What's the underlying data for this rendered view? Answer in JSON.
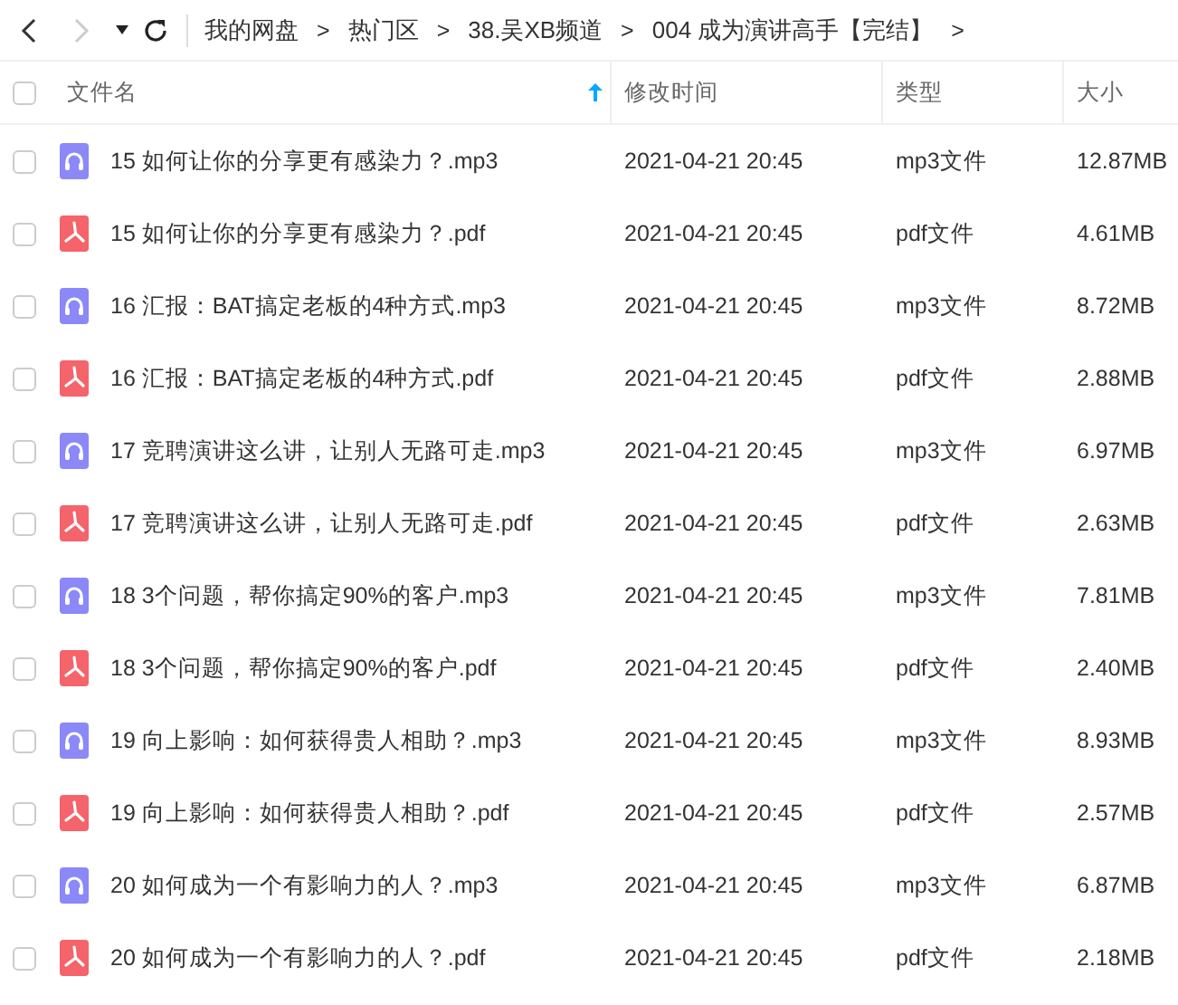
{
  "toolbar": {
    "back_disabled": false,
    "forward_disabled": true
  },
  "breadcrumbs": [
    {
      "label": "我的网盘",
      "separator": ">"
    },
    {
      "label": "热门区",
      "separator": ">"
    },
    {
      "label": "38.吴XB频道",
      "separator": ">"
    },
    {
      "label": "004 成为演讲高手【完结】",
      "separator": ">"
    }
  ],
  "table": {
    "select_all_checked": false,
    "columns": [
      {
        "label": "文件名",
        "sorted": true
      },
      {
        "label": "修改时间",
        "sorted": false
      },
      {
        "label": "类型",
        "sorted": false
      },
      {
        "label": "大小",
        "sorted": false
      }
    ],
    "rows": [
      {
        "kind": "audio",
        "checked": false,
        "name": "15 如何让你的分享更有感染力？.mp3",
        "modified": "2021-04-21 20:45",
        "type": "mp3文件",
        "size": "12.87MB"
      },
      {
        "kind": "pdf",
        "checked": false,
        "name": "15 如何让你的分享更有感染力？.pdf",
        "modified": "2021-04-21 20:45",
        "type": "pdf文件",
        "size": "4.61MB"
      },
      {
        "kind": "audio",
        "checked": false,
        "name": "16 汇报：BAT搞定老板的4种方式.mp3",
        "modified": "2021-04-21 20:45",
        "type": "mp3文件",
        "size": "8.72MB"
      },
      {
        "kind": "pdf",
        "checked": false,
        "name": "16 汇报：BAT搞定老板的4种方式.pdf",
        "modified": "2021-04-21 20:45",
        "type": "pdf文件",
        "size": "2.88MB"
      },
      {
        "kind": "audio",
        "checked": false,
        "name": "17 竞聘演讲这么讲，让别人无路可走.mp3",
        "modified": "2021-04-21 20:45",
        "type": "mp3文件",
        "size": "6.97MB"
      },
      {
        "kind": "pdf",
        "checked": false,
        "name": "17 竞聘演讲这么讲，让别人无路可走.pdf",
        "modified": "2021-04-21 20:45",
        "type": "pdf文件",
        "size": "2.63MB"
      },
      {
        "kind": "audio",
        "checked": false,
        "name": "18 3个问题，帮你搞定90%的客户.mp3",
        "modified": "2021-04-21 20:45",
        "type": "mp3文件",
        "size": "7.81MB"
      },
      {
        "kind": "pdf",
        "checked": false,
        "name": "18 3个问题，帮你搞定90%的客户.pdf",
        "modified": "2021-04-21 20:45",
        "type": "pdf文件",
        "size": "2.40MB"
      },
      {
        "kind": "audio",
        "checked": false,
        "name": "19 向上影响：如何获得贵人相助？.mp3",
        "modified": "2021-04-21 20:45",
        "type": "mp3文件",
        "size": "8.93MB"
      },
      {
        "kind": "pdf",
        "checked": false,
        "name": "19 向上影响：如何获得贵人相助？.pdf",
        "modified": "2021-04-21 20:45",
        "type": "pdf文件",
        "size": "2.57MB"
      },
      {
        "kind": "audio",
        "checked": false,
        "name": "20 如何成为一个有影响力的人？.mp3",
        "modified": "2021-04-21 20:45",
        "type": "mp3文件",
        "size": "6.87MB"
      },
      {
        "kind": "pdf",
        "checked": false,
        "name": "20 如何成为一个有影响力的人？.pdf",
        "modified": "2021-04-21 20:45",
        "type": "pdf文件",
        "size": "2.18MB"
      }
    ]
  }
}
